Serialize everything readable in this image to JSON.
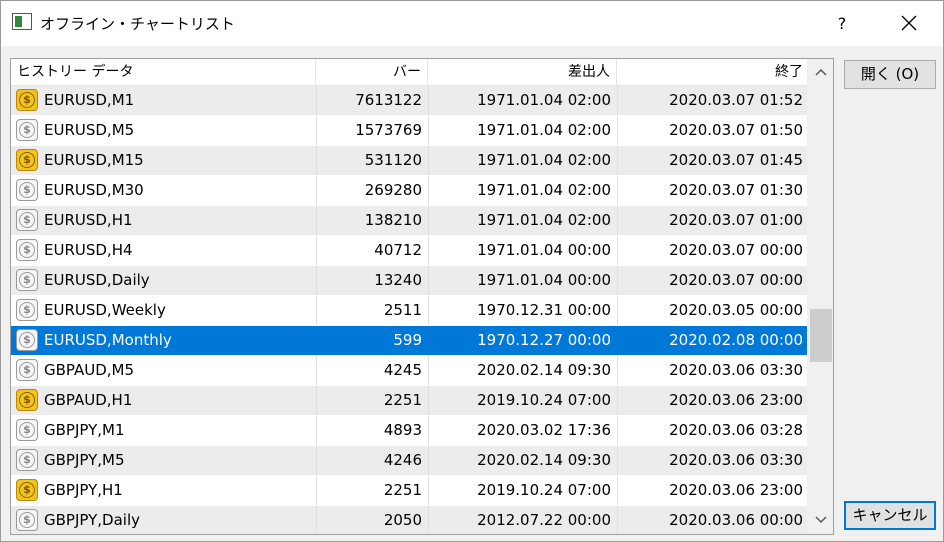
{
  "window": {
    "title": "オフライン・チャートリスト",
    "help_label": "?",
    "icons": {
      "app": "chart-app-icon",
      "close": "close-icon"
    }
  },
  "table": {
    "columns": [
      "ヒストリー データ",
      "バー",
      "差出人",
      "終了"
    ],
    "rows": [
      {
        "symbol": "EURUSD,M1",
        "bars": "7613122",
        "from": "1971.01.04 02:00",
        "to": "2020.03.07 01:52",
        "icon": "gold-coin-icon"
      },
      {
        "symbol": "EURUSD,M5",
        "bars": "1573769",
        "from": "1971.01.04 02:00",
        "to": "2020.03.07 01:50",
        "icon": "gray-coin-icon"
      },
      {
        "symbol": "EURUSD,M15",
        "bars": "531120",
        "from": "1971.01.04 02:00",
        "to": "2020.03.07 01:45",
        "icon": "gold-coin-icon"
      },
      {
        "symbol": "EURUSD,M30",
        "bars": "269280",
        "from": "1971.01.04 02:00",
        "to": "2020.03.07 01:30",
        "icon": "gray-coin-icon"
      },
      {
        "symbol": "EURUSD,H1",
        "bars": "138210",
        "from": "1971.01.04 02:00",
        "to": "2020.03.07 01:00",
        "icon": "gray-coin-icon"
      },
      {
        "symbol": "EURUSD,H4",
        "bars": "40712",
        "from": "1971.01.04 00:00",
        "to": "2020.03.07 00:00",
        "icon": "gray-coin-icon"
      },
      {
        "symbol": "EURUSD,Daily",
        "bars": "13240",
        "from": "1971.01.04 00:00",
        "to": "2020.03.07 00:00",
        "icon": "gray-coin-icon"
      },
      {
        "symbol": "EURUSD,Weekly",
        "bars": "2511",
        "from": "1970.12.31 00:00",
        "to": "2020.03.05 00:00",
        "icon": "gray-coin-icon"
      },
      {
        "symbol": "EURUSD,Monthly",
        "bars": "599",
        "from": "1970.12.27 00:00",
        "to": "2020.02.08 00:00",
        "icon": "gray-coin-icon",
        "selected": true
      },
      {
        "symbol": "GBPAUD,M5",
        "bars": "4245",
        "from": "2020.02.14 09:30",
        "to": "2020.03.06 03:30",
        "icon": "gray-coin-icon"
      },
      {
        "symbol": "GBPAUD,H1",
        "bars": "2251",
        "from": "2019.10.24 07:00",
        "to": "2020.03.06 23:00",
        "icon": "gold-coin-icon"
      },
      {
        "symbol": "GBPJPY,M1",
        "bars": "4893",
        "from": "2020.03.02 17:36",
        "to": "2020.03.06 03:28",
        "icon": "gray-coin-icon"
      },
      {
        "symbol": "GBPJPY,M5",
        "bars": "4246",
        "from": "2020.02.14 09:30",
        "to": "2020.03.06 03:30",
        "icon": "gray-coin-icon"
      },
      {
        "symbol": "GBPJPY,H1",
        "bars": "2251",
        "from": "2019.10.24 07:00",
        "to": "2020.03.06 23:00",
        "icon": "gold-coin-icon"
      },
      {
        "symbol": "GBPJPY,Daily",
        "bars": "2050",
        "from": "2012.07.22 00:00",
        "to": "2020.03.06 00:00",
        "icon": "gray-coin-icon"
      }
    ]
  },
  "buttons": {
    "open": "開く (O)",
    "cancel": "キャンセル"
  },
  "colors": {
    "selection": "#0078d7",
    "alt_row": "#ececec",
    "gold_coin": "#f4c21c",
    "dialog_bg": "#f0f0f0"
  }
}
